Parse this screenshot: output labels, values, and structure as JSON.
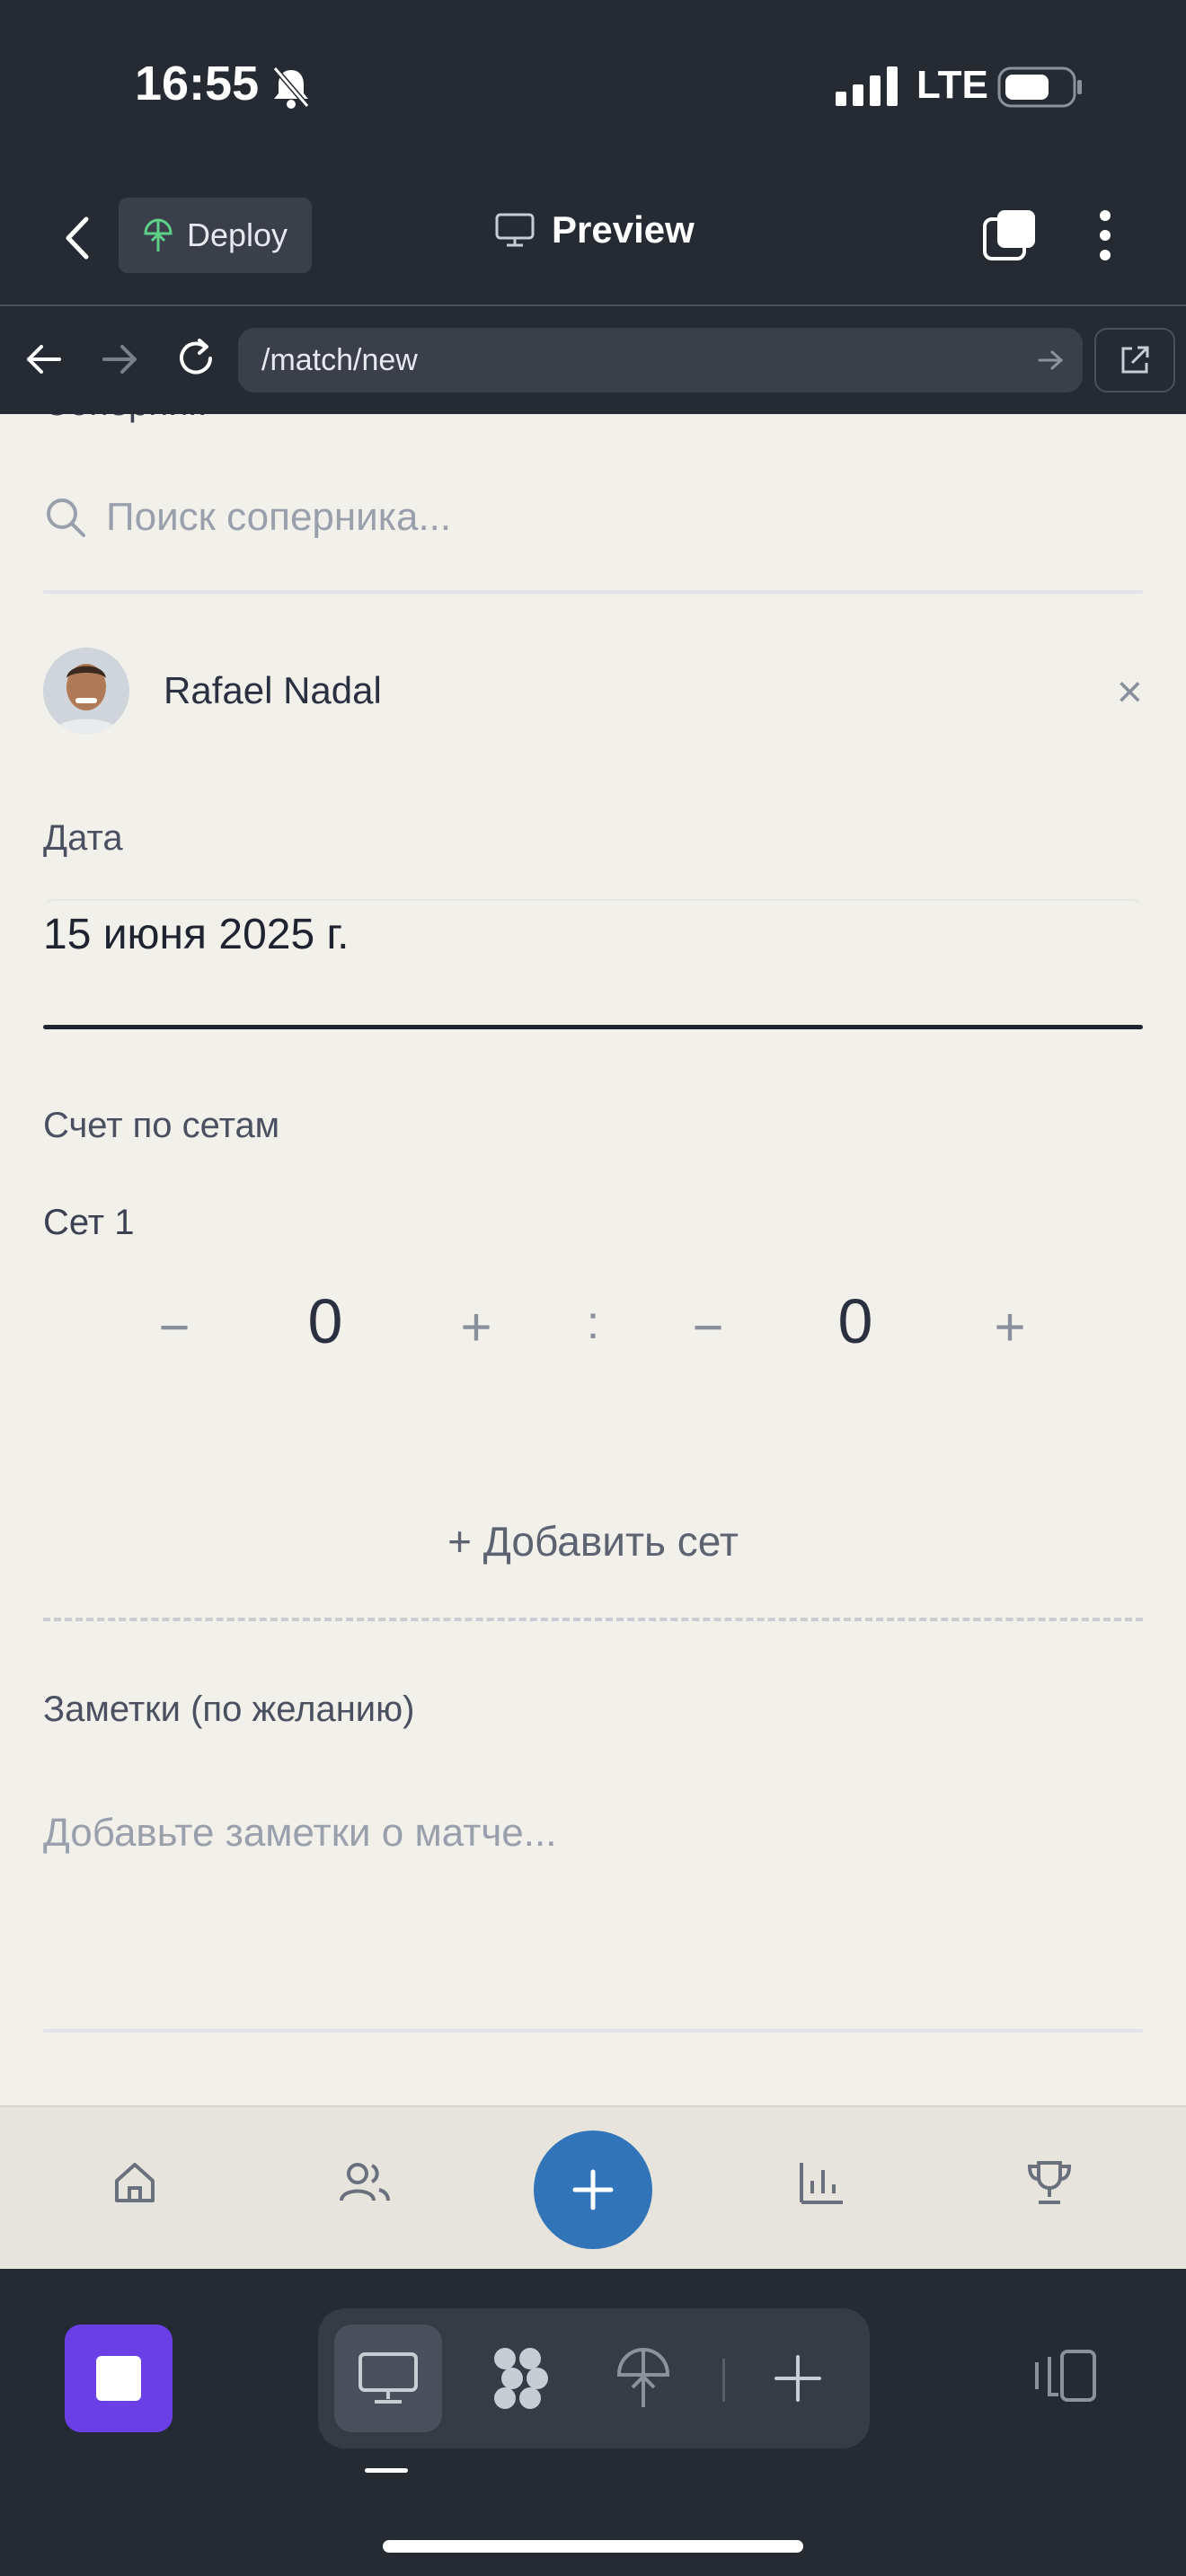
{
  "status": {
    "time": "16:55",
    "network": "LTE"
  },
  "topbar": {
    "deploy_label": "Deploy",
    "preview_label": "Preview"
  },
  "browser": {
    "url": "/match/new"
  },
  "form": {
    "opponent_label_partial": "Соперник",
    "search_placeholder": "Поиск соперника...",
    "opponent_name": "Rafael Nadal",
    "clear_symbol": "×",
    "date_label": "Дата",
    "date_value": "15 июня 2025 г.",
    "score_label": "Счет по сетам",
    "set_label": "Сет 1",
    "score_a": "0",
    "score_b": "0",
    "minus": "−",
    "plus": "+",
    "colon": ":",
    "add_set": "+ Добавить сет",
    "notes_label": "Заметки (по желанию)",
    "notes_placeholder": "Добавьте заметки о матче..."
  },
  "bottomnav": {
    "items": [
      "home-icon",
      "users-icon",
      "plus-icon",
      "stats-icon",
      "trophy-icon"
    ],
    "fab_color": "#3274b8"
  },
  "dock": {
    "stop_color": "#6a3fe6",
    "items": [
      "desktop-icon",
      "apps-icon",
      "deploy-icon",
      "add-icon"
    ]
  }
}
